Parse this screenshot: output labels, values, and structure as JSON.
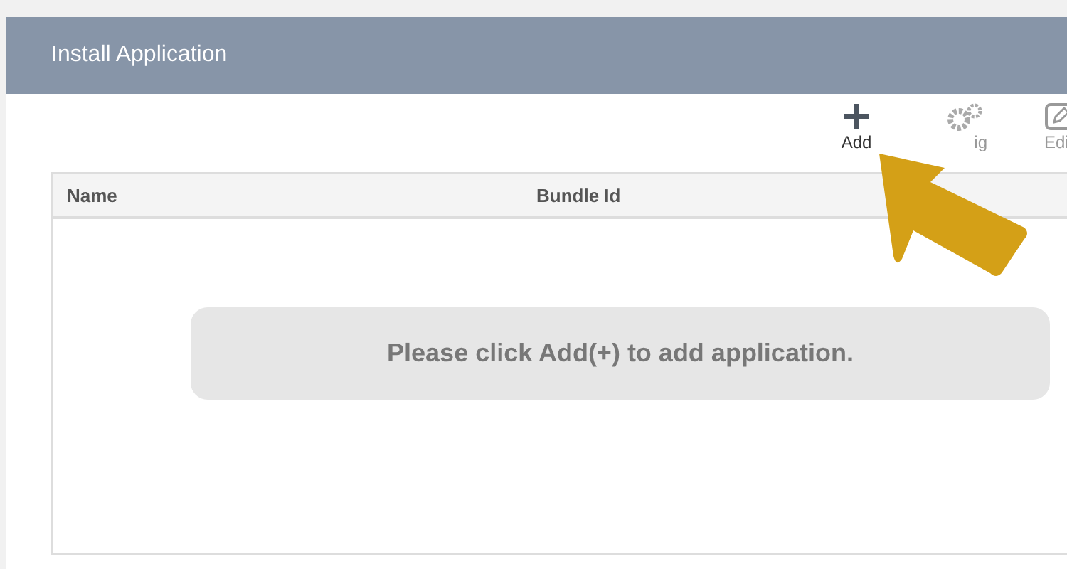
{
  "window": {
    "title": "Install Application"
  },
  "toolbar": [
    {
      "kind": "add",
      "label": "Add"
    },
    {
      "kind": "config",
      "label": "ig"
    },
    {
      "kind": "edit",
      "label": "Edi"
    }
  ],
  "table": {
    "columns": [
      "Name",
      "Bundle Id"
    ]
  },
  "empty_message": "Please click Add(+) to add application."
}
